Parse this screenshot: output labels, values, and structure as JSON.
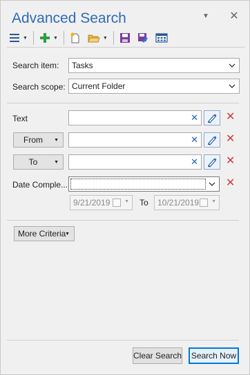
{
  "header": {
    "title": "Advanced Search",
    "pin_glyph": "▼",
    "close_glyph": "✕"
  },
  "toolbar": {
    "icons": [
      "menu-icon",
      "add-icon",
      "new-file-icon",
      "open-folder-icon",
      "save-icon",
      "save-as-icon",
      "layout-icon"
    ]
  },
  "form": {
    "search_item_label": "Search item:",
    "search_item_value": "Tasks",
    "search_scope_label": "Search scope:",
    "search_scope_value": "Current Folder",
    "text_label": "Text",
    "text_value": "",
    "from_label": "From",
    "from_value": "",
    "to_label": "To",
    "to_value": "",
    "date_label": "Date Comple...",
    "date_value": "",
    "date_from": "9/21/2019",
    "date_to_label": "To",
    "date_to": "10/21/2019",
    "clear_glyph": "✕",
    "remove_glyph": "✕"
  },
  "more_criteria_label": "More Criteria",
  "footer": {
    "clear_label": "Clear Search",
    "search_label": "Search Now"
  },
  "colors": {
    "accent": "#2e6bb5",
    "clear_blue": "#1f5fbf",
    "remove_red": "#d23b3b",
    "add_green": "#2e9e3e"
  }
}
